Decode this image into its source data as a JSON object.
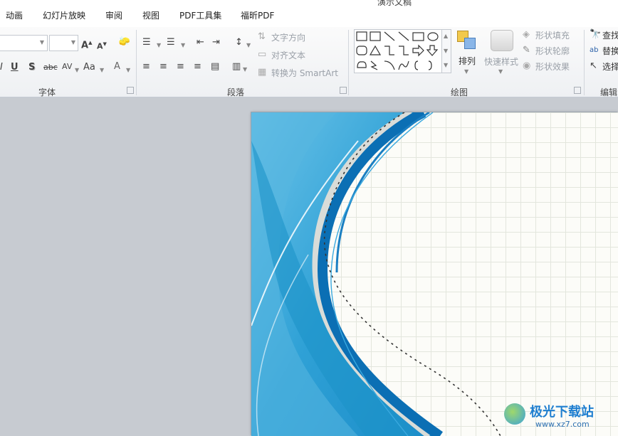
{
  "tabs": [
    "动画",
    "幻灯片放映",
    "审阅",
    "视图",
    "PDF工具集",
    "福昕PDF"
  ],
  "title_fragment": "演示文稿",
  "font_group": {
    "label": "字体",
    "font_size_value": "",
    "buttons": [
      "U",
      "S",
      "abc",
      "AV",
      "Aa",
      "A"
    ]
  },
  "paragraph_group": {
    "label": "段落",
    "text_direction": "文字方向",
    "align_text": "对齐文本",
    "convert_smartart": "转换为 SmartArt"
  },
  "drawing_group": {
    "label": "绘图",
    "arrange": "排列",
    "quick_styles": "快速样式",
    "shape_fill": "形状填充",
    "shape_outline": "形状轮廓",
    "shape_effects": "形状效果"
  },
  "editing_group": {
    "label": "编辑",
    "find": "查找",
    "replace": "替换",
    "select": "选择"
  },
  "watermark": {
    "brand": "极光下载站",
    "url": "www.xz7.com"
  },
  "colors": {
    "slide_blue_dark": "#0b6fb4",
    "slide_blue_light": "#5ab8e2",
    "ribbon_bg": "#f3f4f6",
    "workspace_bg": "#c7cbd1"
  }
}
